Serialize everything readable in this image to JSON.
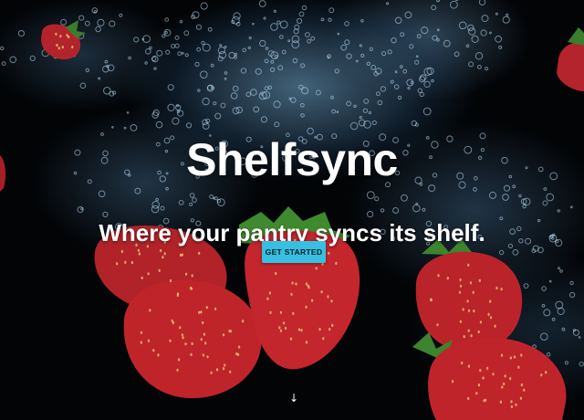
{
  "hero": {
    "title": "Shelfsync",
    "tagline": "Where your pantry syncs its shelf.",
    "cta_label": "GET STARTED",
    "scroll_icon": "↓",
    "background_image": "strawberries-in-water",
    "colors": {
      "accent": "#37bfe1",
      "text": "#ffffff",
      "background": "#000000",
      "berry": "#c0242b"
    }
  }
}
